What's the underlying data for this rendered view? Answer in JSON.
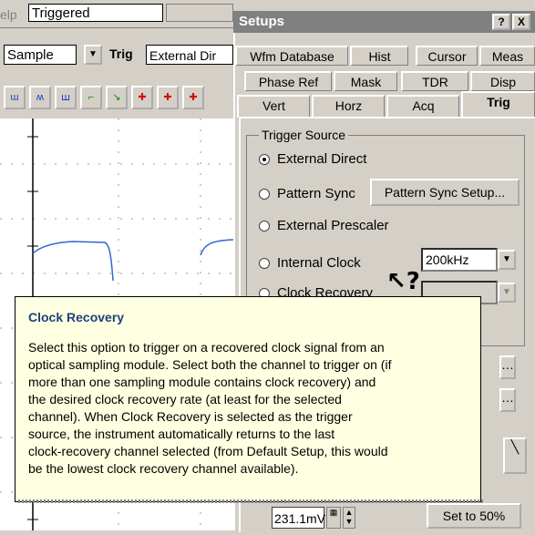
{
  "app": {
    "menu_help": "elp",
    "status": "Triggered",
    "acquisition_mode": "Sample",
    "trig_label": "Trig",
    "trig_source_field": "External Dir"
  },
  "dialog": {
    "title": "Setups",
    "help_button": "?",
    "close_button": "X",
    "tabs_row1": [
      "Wfm Database",
      "Hist",
      "Cursor",
      "Meas"
    ],
    "tabs_row2": [
      "Phase Ref",
      "Mask",
      "TDR",
      "Disp"
    ],
    "tabs_row3": [
      "Vert",
      "Horz",
      "Acq",
      "Trig"
    ],
    "active_tab": "Trig",
    "group_title": "Trigger Source",
    "options": [
      {
        "label": "External Direct",
        "selected": true
      },
      {
        "label": "Pattern Sync",
        "selected": false
      },
      {
        "label": "External Prescaler",
        "selected": false
      },
      {
        "label": "Internal Clock",
        "selected": false
      },
      {
        "label": "Clock Recovery",
        "selected": false
      }
    ],
    "pattern_sync_button": "Pattern Sync Setup...",
    "internal_clock_rate": "200kHz",
    "clock_recovery_rate": "",
    "level_value": "231.1mV",
    "set50_button": "Set to 50%"
  },
  "tooltip": {
    "title": "Clock Recovery",
    "lines": [
      "Select this option to trigger on a recovered clock signal from an",
      "optical sampling module. Select both the channel to trigger on (if",
      "more than one sampling module contains clock recovery) and",
      "the desired clock recovery rate (at least for the selected",
      "channel). When Clock Recovery is selected as the trigger",
      "source, the instrument automatically returns to the last",
      "clock-recovery channel selected (from Default Setup, this would",
      "be the lowest clock recovery channel available)."
    ]
  },
  "colors": {
    "tooltip_bg": "#ffffe1",
    "tooltip_title": "#1f3f7f",
    "waveform": "#3366cc",
    "titlebar": "#808080"
  }
}
